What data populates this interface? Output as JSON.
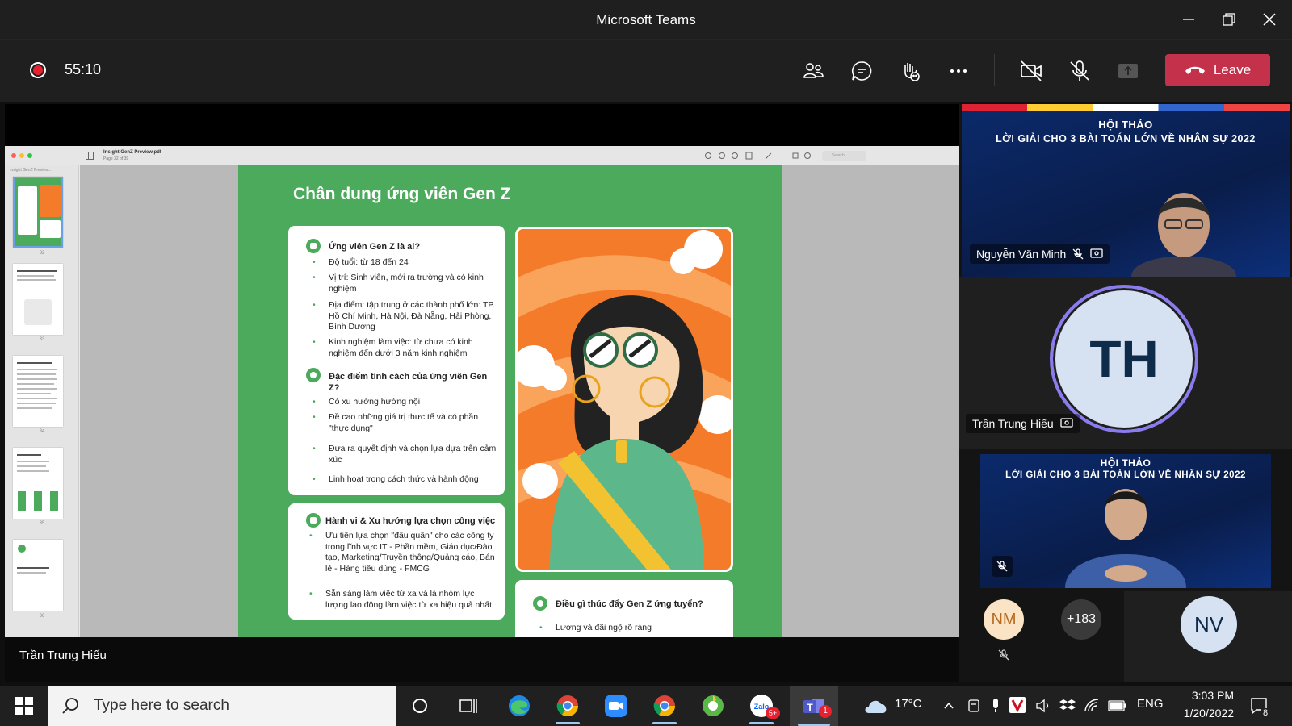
{
  "window": {
    "title": "Microsoft Teams"
  },
  "toolbar": {
    "timer": "55:10",
    "leave_label": "Leave"
  },
  "pdf": {
    "filename": "Insight GenZ Preview.pdf",
    "page_info": "Page 32 of 39",
    "sidebar_label": "Insight GenZ Preview...",
    "search_placeholder": "Search",
    "thumbnails": [
      "32",
      "33",
      "34",
      "35",
      "36"
    ]
  },
  "slide": {
    "title": "Chân dung ứng viên Gen Z",
    "card1": {
      "heading": "Ứng viên Gen Z là ai?",
      "bullets": [
        "Độ tuổi: từ 18 đến 24",
        "Vị trí: Sinh viên, mới ra trường và có kinh nghiệm",
        "Địa điểm: tập trung ở các thành phố lớn: TP. Hồ Chí Minh, Hà Nội, Đà Nẵng, Hải Phòng, Bình Dương",
        "Kinh nghiệm làm việc: từ chưa có kinh nghiệm đến dưới 3 năm kinh nghiệm"
      ],
      "heading2": "Đặc điểm tính cách của ứng viên Gen Z?",
      "bullets2": [
        "Có xu hướng hướng nội",
        "Đề cao những giá trị thực tế và có phần \"thực dụng\"",
        "Đưa ra quyết định và chọn lựa dựa trên cảm xúc",
        "Linh hoạt trong cách thức và hành động"
      ]
    },
    "card2": {
      "heading": "Hành vi & Xu hướng lựa chọn công việc",
      "bullets": [
        "Ưu tiên lựa chọn \"đầu quân\" cho các công ty trong lĩnh vực IT - Phần mềm, Giáo dục/Đào tạo, Marketing/Truyền thông/Quảng cáo, Bán lẻ - Hàng tiêu dùng - FMCG",
        "Sẵn sàng làm việc từ xa và là nhóm lực lượng lao động làm việc từ xa hiệu quả nhất"
      ]
    },
    "card3": {
      "heading": "Điều gì thúc đẩy Gen Z ứng tuyển?",
      "bullets": [
        "Lương và đãi ngộ rõ ràng"
      ]
    }
  },
  "participants": {
    "tile1": {
      "banner_top": "HỘI THẢO",
      "banner_main": "LỜI GIẢI CHO 3 BÀI TOÁN LỚN VỀ NHÂN SỰ 2022",
      "name": "Nguyễn Văn Minh"
    },
    "tile2": {
      "initials": "TH",
      "name": "Trần Trung Hiếu"
    },
    "tile3": {
      "banner_top": "HỘI THẢO",
      "banner_main": "LỜI GIẢI CHO 3 BÀI TOÁN LỚN VỀ NHÂN SỰ 2022"
    },
    "small": [
      {
        "initials": "NM"
      },
      {
        "label": "+183"
      },
      {
        "initials": "NV"
      }
    ]
  },
  "stage": {
    "speaker_name": "Trần Trung Hiếu"
  },
  "taskbar": {
    "search_placeholder": "Type here to search",
    "zalo_badge": "5+",
    "teams_badge": "1",
    "temperature": "17°C",
    "language": "ENG",
    "time": "3:03 PM",
    "date": "1/20/2022",
    "notification_count": "8"
  },
  "colors": {
    "accent_red": "#c4314b",
    "slide_green": "#4caa5c",
    "avatar_ring": "#8a7cf0"
  }
}
